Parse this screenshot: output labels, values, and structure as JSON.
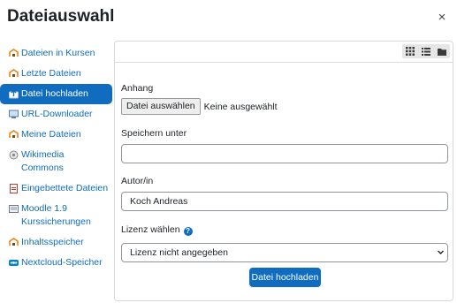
{
  "dialog": {
    "title": "Dateiauswahl",
    "close_glyph": "×"
  },
  "sidebar": {
    "items": [
      {
        "label": "Dateien in Kursen",
        "icon": "repository-icon",
        "active": false
      },
      {
        "label": "Letzte Dateien",
        "icon": "recent-files-icon",
        "active": false
      },
      {
        "label": "Datei hochladen",
        "icon": "upload-icon",
        "active": true
      },
      {
        "label": "URL-Downloader",
        "icon": "url-downloader-icon",
        "active": false
      },
      {
        "label": "Meine Dateien",
        "icon": "private-files-icon",
        "active": false
      },
      {
        "label": "Wikimedia Commons",
        "icon": "wikimedia-icon",
        "active": false
      },
      {
        "label": "Eingebettete Dateien",
        "icon": "embedded-files-icon",
        "active": false
      },
      {
        "label": "Moodle 1.9 Kurssicherungen",
        "icon": "backup-icon",
        "active": false
      },
      {
        "label": "Inhaltsspeicher",
        "icon": "content-bank-icon",
        "active": false
      },
      {
        "label": "Nextcloud-Speicher",
        "icon": "nextcloud-icon",
        "active": false
      }
    ]
  },
  "toolbar": {
    "views": [
      "grid-view-icon",
      "list-view-icon",
      "folder-view-icon"
    ]
  },
  "form": {
    "attachment_label": "Anhang",
    "choose_file_button": "Datei auswählen",
    "no_file_text": "Keine ausgewählt",
    "save_as_label": "Speichern unter",
    "save_as_value": "",
    "author_label": "Autor/in",
    "author_value": "Koch Andreas",
    "license_label": "Lizenz wählen",
    "license_selected": "Lizenz nicht angegeben",
    "submit_button": "Datei hochladen"
  },
  "colors": {
    "accent": "#0f6cbf",
    "icon_orange": "#e8851a"
  }
}
